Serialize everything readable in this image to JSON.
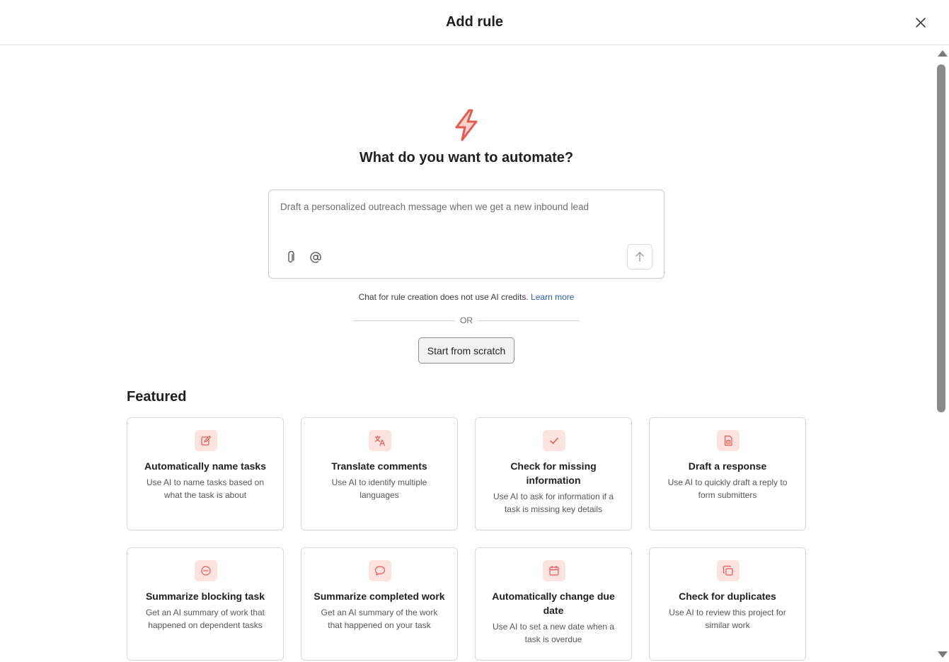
{
  "header": {
    "title": "Add rule"
  },
  "hero": {
    "title": "What do you want to automate?"
  },
  "prompt": {
    "placeholder": "Draft a personalized outreach message when we get a new inbound lead"
  },
  "note": {
    "text": "Chat for rule creation does not use AI credits.",
    "link": "Learn more"
  },
  "divider": {
    "label": "OR"
  },
  "scratch": {
    "label": "Start from scratch"
  },
  "featured": {
    "title": "Featured",
    "cards": [
      {
        "title": "Automatically name tasks",
        "desc": "Use AI to name tasks based on what the task is about",
        "icon": "edit-icon"
      },
      {
        "title": "Translate comments",
        "desc": "Use AI to identify multiple languages",
        "icon": "translate-icon"
      },
      {
        "title": "Check for missing information",
        "desc": "Use AI to ask for information if a task is missing key details",
        "icon": "check-icon"
      },
      {
        "title": "Draft a response",
        "desc": "Use AI to quickly draft a reply to form submitters",
        "icon": "document-icon"
      },
      {
        "title": "Summarize blocking task",
        "desc": "Get an AI summary of work that happened on dependent tasks",
        "icon": "blocked-icon"
      },
      {
        "title": "Summarize completed work",
        "desc": "Get an AI summary of the work that happened on your task",
        "icon": "comment-icon"
      },
      {
        "title": "Automatically change due date",
        "desc": "Use AI to set a new date when a task is overdue",
        "icon": "calendar-icon"
      },
      {
        "title": "Check for duplicates",
        "desc": "Use AI to review this project for similar work",
        "icon": "duplicate-icon"
      }
    ]
  },
  "colors": {
    "accent": "#e8584f",
    "icon_bg": "#fde3df",
    "link": "#2c5ca8"
  }
}
